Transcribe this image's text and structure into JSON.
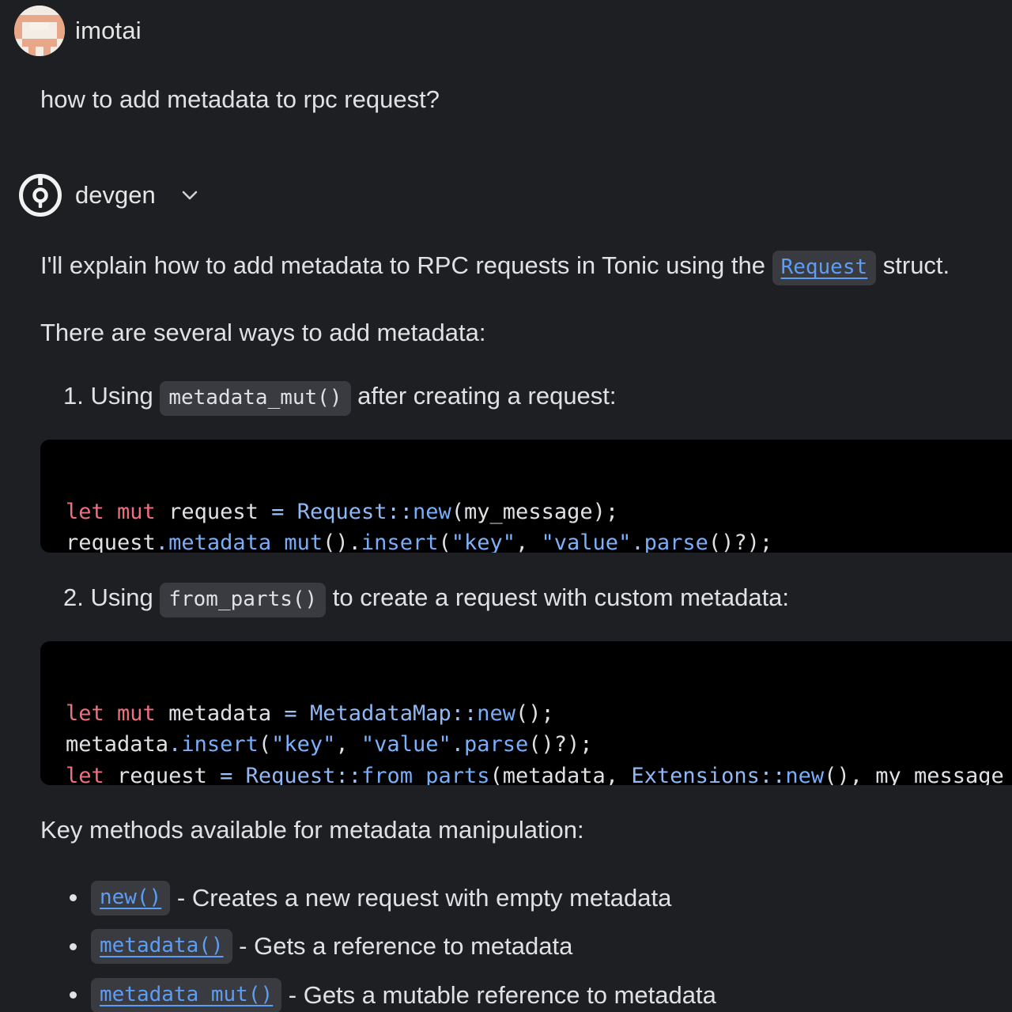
{
  "user": {
    "name": "imotai",
    "question": "how to add metadata to rpc request?"
  },
  "assistant": {
    "name": "devgen",
    "intro_before": "I'll explain how to add metadata to RPC requests in Tonic using the ",
    "intro_link": "Request",
    "intro_after": " struct.",
    "several_ways": "There are several ways to add metadata:",
    "step1": {
      "prefix": "1. Using ",
      "code": "metadata_mut()",
      "suffix": " after creating a request:"
    },
    "step2": {
      "prefix": "2. Using ",
      "code": "from_parts()",
      "suffix": " to create a request with custom metadata:"
    },
    "code1": {
      "t_let": "let",
      "t_mut": "mut",
      "t_request": "request",
      "t_eq": "=",
      "t_Request": "Request",
      "t_dc": "::",
      "t_new": "new",
      "t_args1": "(my_message);",
      "t_request2": "request",
      "t_dot": ".",
      "t_metadata_mut": "metadata_mut",
      "t_paren_dot": "().",
      "t_insert": "insert",
      "t_open": "(",
      "t_key": "\"key\"",
      "t_comma": ", ",
      "t_value": "\"value\"",
      "t_dot2": ".",
      "t_parse": "parse",
      "t_close": "()?);"
    },
    "code2": {
      "l1_let": "let",
      "l1_mut": "mut",
      "l1_metadata": "metadata",
      "l1_eq": "=",
      "l1_MetadataMap": "MetadataMap",
      "l1_dc": "::",
      "l1_new": "new",
      "l1_end": "();",
      "l2_metadata": "metadata",
      "l2_dot": ".",
      "l2_insert": "insert",
      "l2_open": "(",
      "l2_key": "\"key\"",
      "l2_comma": ", ",
      "l2_value": "\"value\"",
      "l2_dot2": ".",
      "l2_parse": "parse",
      "l2_close": "()?);",
      "l3_let": "let",
      "l3_request": "request",
      "l3_eq": "=",
      "l3_Request": "Request",
      "l3_dc": "::",
      "l3_from_parts": "from_parts",
      "l3_args": "(metadata, ",
      "l3_Extensions": "Extensions",
      "l3_dc2": "::",
      "l3_new": "new",
      "l3_tail": "(), my_message"
    },
    "key_methods": "Key methods available for metadata manipulation:",
    "methods": [
      {
        "code": "new()",
        "desc": " - Creates a new request with empty metadata"
      },
      {
        "code": "metadata()",
        "desc": " - Gets a reference to metadata"
      },
      {
        "code": "metadata_mut()",
        "desc": " - Gets a mutable reference to metadata"
      }
    ]
  }
}
